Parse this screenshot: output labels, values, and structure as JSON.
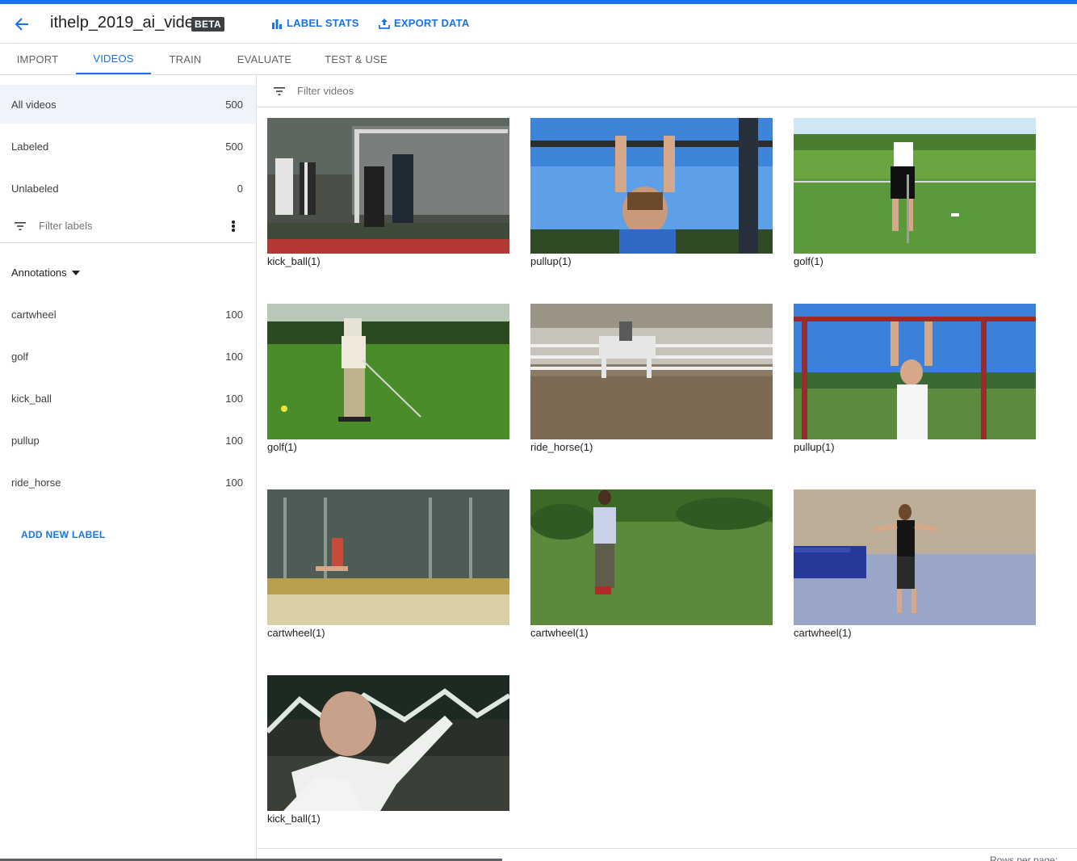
{
  "app": {
    "title": "ithelp_2019_ai_video",
    "badge": "BETA",
    "accent": "#1a73e8"
  },
  "header": {
    "back_icon": "arrow-left-icon",
    "label_stats": "LABEL STATS",
    "export_data": "EXPORT DATA"
  },
  "tabs": [
    {
      "label": "IMPORT"
    },
    {
      "label": "VIDEOS",
      "active": true
    },
    {
      "label": "TRAIN"
    },
    {
      "label": "EVALUATE"
    },
    {
      "label": "TEST & USE"
    }
  ],
  "sidebar": {
    "views": [
      {
        "label": "All videos",
        "count": "500",
        "selected": true
      },
      {
        "label": "Labeled",
        "count": "500"
      },
      {
        "label": "Unlabeled",
        "count": "0"
      }
    ],
    "filter_placeholder": "Filter labels",
    "annotations_heading": "Annotations",
    "labels": [
      {
        "label": "cartwheel",
        "count": "100"
      },
      {
        "label": "golf",
        "count": "100"
      },
      {
        "label": "kick_ball",
        "count": "100"
      },
      {
        "label": "pullup",
        "count": "100"
      },
      {
        "label": "ride_horse",
        "count": "100"
      }
    ],
    "add_label": "ADD NEW LABEL"
  },
  "main": {
    "filter_placeholder": "Filter videos",
    "videos": [
      {
        "caption": "kick_ball(1)",
        "scene": "soccer"
      },
      {
        "caption": "pullup(1)",
        "scene": "pullup-bar"
      },
      {
        "caption": "golf(1)",
        "scene": "golf-field"
      },
      {
        "caption": "golf(1)",
        "scene": "golf-swing"
      },
      {
        "caption": "ride_horse(1)",
        "scene": "horse"
      },
      {
        "caption": "pullup(1)",
        "scene": "pullup-outdoor"
      },
      {
        "caption": "cartwheel(1)",
        "scene": "gym-hall"
      },
      {
        "caption": "cartwheel(1)",
        "scene": "lawn"
      },
      {
        "caption": "cartwheel(1)",
        "scene": "gym-mat"
      },
      {
        "caption": "kick_ball(1)",
        "scene": "celebration"
      }
    ]
  },
  "footer": {
    "rows_per_page": "Rows per page:"
  }
}
